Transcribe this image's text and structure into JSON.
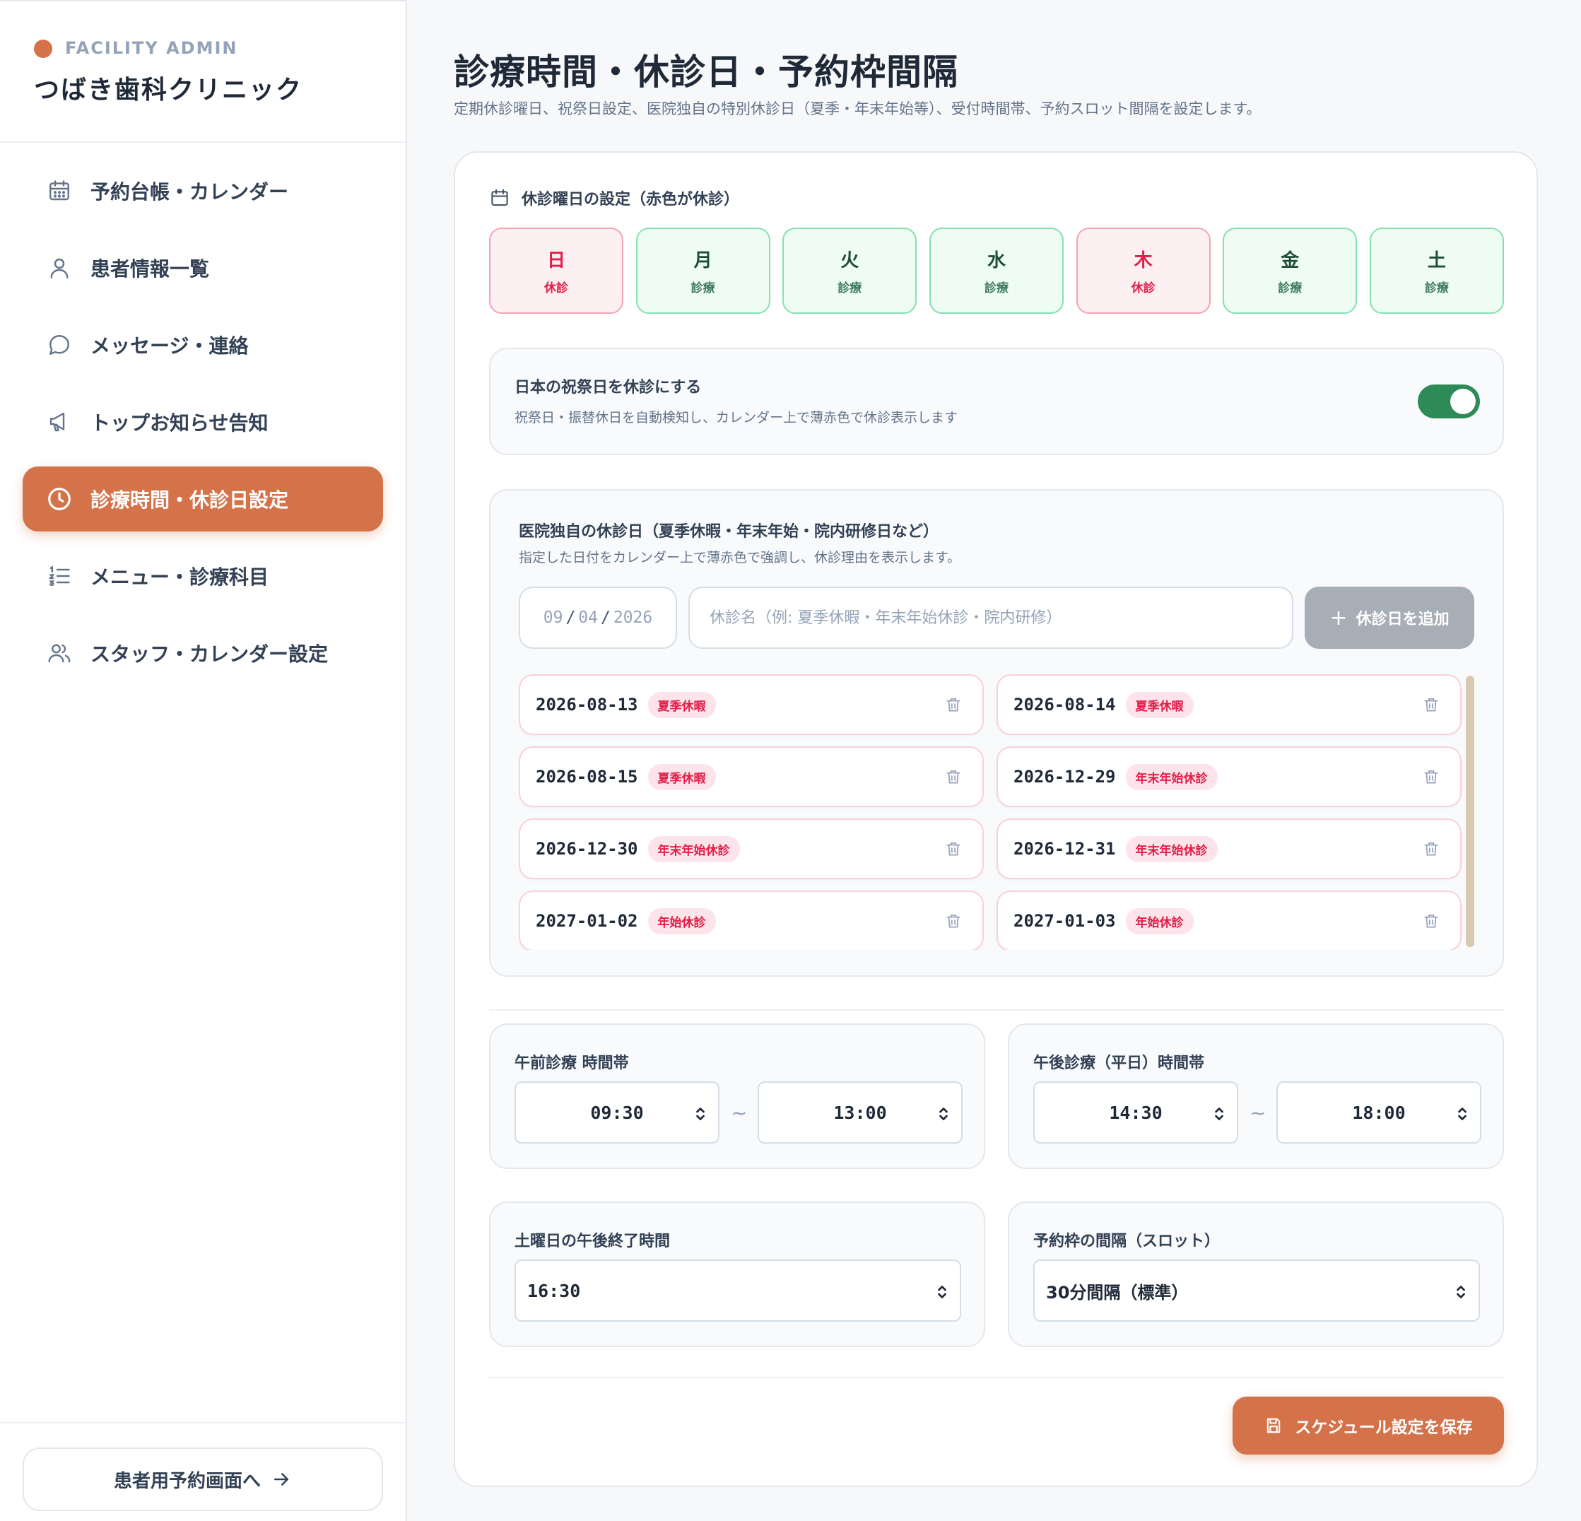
{
  "sidebar": {
    "brand_tag": "FACILITY ADMIN",
    "brand_name": "つばき歯科クリニック",
    "items": [
      {
        "label": "予約台帳・カレンダー",
        "icon": "calendar-icon"
      },
      {
        "label": "患者情報一覧",
        "icon": "user-icon"
      },
      {
        "label": "メッセージ・連絡",
        "icon": "chat-bubble-icon"
      },
      {
        "label": "トップお知らせ告知",
        "icon": "megaphone-icon"
      },
      {
        "label": "診療時間・休診日設定",
        "icon": "clock-icon",
        "active": true
      },
      {
        "label": "メニュー・診療科目",
        "icon": "numbered-list-icon"
      },
      {
        "label": "スタッフ・カレンダー設定",
        "icon": "users-icon"
      }
    ],
    "patient_link": "患者用予約画面へ"
  },
  "header": {
    "title": "診療時間・休診日・予約枠間隔",
    "subtitle": "定期休診曜日、祝祭日設定、医院独自の特別休診日（夏季・年末年始等）、受付時間帯、予約スロット間隔を設定します。"
  },
  "weekdays": {
    "heading": "休診曜日の設定（赤色が休診）",
    "days": [
      {
        "name": "日",
        "status": "休診"
      },
      {
        "name": "月",
        "status": "診療"
      },
      {
        "name": "火",
        "status": "診療"
      },
      {
        "name": "水",
        "status": "診療"
      },
      {
        "name": "木",
        "status": "休診"
      },
      {
        "name": "金",
        "status": "診療"
      },
      {
        "name": "土",
        "status": "診療"
      }
    ]
  },
  "holidays": {
    "title": "日本の祝祭日を休診にする",
    "description": "祝祭日・振替休日を自動検知し、カレンダー上で薄赤色で休診表示します",
    "enabled": true
  },
  "custom": {
    "title": "医院独自の休診日（夏季休暇・年末年始・院内研修日など）",
    "description": "指定した日付をカレンダー上で薄赤色で強調し、休診理由を表示します。",
    "date_mm": "09",
    "date_dd": "04",
    "date_yyyy": "2026",
    "name_placeholder": "休診名（例: 夏季休暇・年末年始休診・院内研修）",
    "add_label": "休診日を追加",
    "list": [
      {
        "date": "2026-08-13",
        "tag": "夏季休暇"
      },
      {
        "date": "2026-08-14",
        "tag": "夏季休暇"
      },
      {
        "date": "2026-08-15",
        "tag": "夏季休暇"
      },
      {
        "date": "2026-12-29",
        "tag": "年末年始休診"
      },
      {
        "date": "2026-12-30",
        "tag": "年末年始休診"
      },
      {
        "date": "2026-12-31",
        "tag": "年末年始休診"
      },
      {
        "date": "2027-01-02",
        "tag": "年始休診"
      },
      {
        "date": "2027-01-03",
        "tag": "年始休診"
      }
    ]
  },
  "hours": {
    "am_label": "午前診療 時間帯",
    "am_start": "09:30",
    "am_end": "13:00",
    "pm_label": "午後診療（平日）時間帯",
    "pm_start": "14:30",
    "pm_end": "18:00",
    "tilde": "~",
    "sat_label": "土曜日の午後終了時間",
    "sat_end": "16:30",
    "slot_label": "予約枠の間隔（スロット）",
    "slot_value": "30分間隔（標準）"
  },
  "save_label": "スケジュール設定を保存",
  "colors": {
    "accent": "#d4724a",
    "closed": "#e11d48",
    "open": "#2e8b57"
  }
}
